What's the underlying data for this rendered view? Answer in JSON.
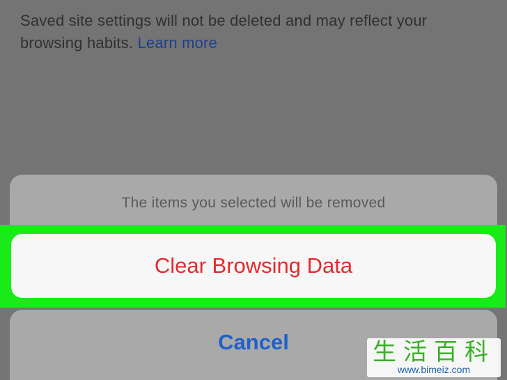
{
  "settings_text": {
    "body": "Saved site settings will not be deleted and may reflect your browsing habits.",
    "link_label": "Learn more"
  },
  "action_sheet": {
    "message": "The items you selected will be removed",
    "destructive_label": "Clear Browsing Data",
    "cancel_label": "Cancel"
  },
  "watermark": {
    "title": "生活百科",
    "url": "www.bimeiz.com"
  },
  "colors": {
    "overlay": "#747474",
    "highlight": "#19eb18",
    "destructive": "#e32a2f",
    "cancel": "#1e62c9",
    "link": "#1f3f8f"
  }
}
